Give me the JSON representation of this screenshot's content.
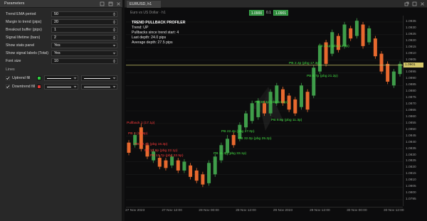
{
  "panel": {
    "title": "Parameters",
    "icons": [
      "pin-icon",
      "maximize-icon",
      "close-icon"
    ],
    "params": [
      {
        "label": "Trend EMA period",
        "value": "50"
      },
      {
        "label": "Margin to trend (pips)",
        "value": "20"
      },
      {
        "label": "Breakout buffer (pips)",
        "value": "1"
      },
      {
        "label": "Signal lifetime (bars)",
        "value": "2"
      },
      {
        "label": "Show stats panel",
        "value": "Yes"
      },
      {
        "label": "Show signal labels (Total)",
        "value": "Yes"
      },
      {
        "label": "Font size",
        "value": "10"
      }
    ],
    "lines_header": "Lines",
    "lines": [
      {
        "label": "Uptrend fill",
        "color": "#2ecc40",
        "checked": true
      },
      {
        "label": "Downtrend fill",
        "color": "#e53935",
        "checked": true
      }
    ]
  },
  "chart_window": {
    "tab_label": "EURUSD, h1",
    "header_text": "Euro vs US Dollar · h1",
    "sell_price": "1.0900",
    "spread": "0.1",
    "buy_price": "1.0901",
    "icons": [
      "detach-icon",
      "maximize-icon",
      "close-icon"
    ]
  },
  "info": {
    "title": "TREND PULLBACK PROFILER",
    "lines": [
      "Trend: UP",
      "Pullbacks since trend start: 4",
      "Last depth: 24.0 pips",
      "Average depth: 27.5 pips"
    ]
  },
  "chart_data": {
    "type": "candlestick",
    "ylim": [
      1.079,
      1.094
    ],
    "up_color": "#3f9d4a",
    "down_color": "#e8692e",
    "current_price": 1.0901,
    "current_price_label": "1.0901",
    "price_line_color": "#c9c46a",
    "y_ticks": [
      "1.0935",
      "1.0930",
      "1.0925",
      "1.0920",
      "1.0915",
      "1.0910",
      "1.0905",
      "1.0900",
      "1.0895",
      "1.0890",
      "1.0885",
      "1.0880",
      "1.0875",
      "1.0870",
      "1.0865",
      "1.0860",
      "1.0855",
      "1.0850",
      "1.0845",
      "1.0840",
      "1.0835",
      "1.0830",
      "1.0825",
      "1.0820",
      "1.0815",
      "1.0810",
      "1.0805",
      "1.0800",
      "1.0795"
    ],
    "x_ticks": [
      {
        "candle": 1,
        "label": "27 Nov 2023"
      },
      {
        "candle": 7,
        "label": "27 Nov 12:00"
      },
      {
        "candle": 13,
        "label": "28 Nov 00:00"
      },
      {
        "candle": 19,
        "label": "28 Nov 12:00"
      },
      {
        "candle": 25,
        "label": "29 Nov 2023"
      },
      {
        "candle": 31,
        "label": "29 Nov 12:00"
      },
      {
        "candle": 37,
        "label": "30 Nov 00:00"
      },
      {
        "candle": 43,
        "label": "30 Nov 12:00"
      }
    ],
    "candles": [
      [
        1.084,
        1.0842,
        1.083,
        1.0832
      ],
      [
        1.0838,
        1.0848,
        1.0836,
        1.0846
      ],
      [
        1.0852,
        1.0855,
        1.0833,
        1.0835
      ],
      [
        1.0838,
        1.084,
        1.0827,
        1.0829
      ],
      [
        1.0826,
        1.0835,
        1.0824,
        1.0833
      ],
      [
        1.0828,
        1.083,
        1.0819,
        1.0821
      ],
      [
        1.0826,
        1.0828,
        1.0818,
        1.082
      ],
      [
        1.0822,
        1.0831,
        1.082,
        1.0829
      ],
      [
        1.0826,
        1.0828,
        1.0816,
        1.0818
      ],
      [
        1.0818,
        1.0827,
        1.0816,
        1.0825
      ],
      [
        1.0822,
        1.0824,
        1.0811,
        1.0813
      ],
      [
        1.0818,
        1.082,
        1.0808,
        1.081
      ],
      [
        1.0815,
        1.0817,
        1.0805,
        1.0807
      ],
      [
        1.0808,
        1.0826,
        1.0806,
        1.0824
      ],
      [
        1.0815,
        1.0831,
        1.0813,
        1.0829
      ],
      [
        1.0826,
        1.084,
        1.0824,
        1.0838
      ],
      [
        1.0832,
        1.0846,
        1.083,
        1.0843
      ],
      [
        1.0846,
        1.0848,
        1.0836,
        1.0838
      ],
      [
        1.0843,
        1.0856,
        1.0841,
        1.0854
      ],
      [
        1.0852,
        1.0865,
        1.085,
        1.0863
      ],
      [
        1.0857,
        1.0873,
        1.0855,
        1.0871
      ],
      [
        1.086,
        1.0875,
        1.0858,
        1.0873
      ],
      [
        1.0871,
        1.0873,
        1.0861,
        1.0863
      ],
      [
        1.0863,
        1.0882,
        1.0861,
        1.088
      ],
      [
        1.0871,
        1.0887,
        1.0869,
        1.0885
      ],
      [
        1.0882,
        1.0884,
        1.0869,
        1.0871
      ],
      [
        1.0877,
        1.0879,
        1.0864,
        1.0866
      ],
      [
        1.0874,
        1.0876,
        1.0861,
        1.0863
      ],
      [
        1.0868,
        1.0887,
        1.0866,
        1.0885
      ],
      [
        1.088,
        1.0882,
        1.0864,
        1.0866
      ],
      [
        1.0877,
        1.0901,
        1.0875,
        1.0899
      ],
      [
        1.0896,
        1.0918,
        1.0894,
        1.0916
      ],
      [
        1.0919,
        1.0921,
        1.09,
        1.0902
      ],
      [
        1.091,
        1.0929,
        1.0908,
        1.0927
      ],
      [
        1.0924,
        1.0926,
        1.0911,
        1.0913
      ],
      [
        1.0916,
        1.0935,
        1.0914,
        1.0933
      ],
      [
        1.093,
        1.0932,
        1.092,
        1.0922
      ],
      [
        1.0924,
        1.0938,
        1.0922,
        1.0936
      ],
      [
        1.0933,
        1.0935,
        1.0914,
        1.0916
      ],
      [
        1.0919,
        1.0932,
        1.0917,
        1.093
      ],
      [
        1.0922,
        1.0924,
        1.0906,
        1.0908
      ],
      [
        1.091,
        1.0912,
        1.0894,
        1.0896
      ],
      [
        1.0902,
        1.0904,
        1.0886,
        1.0888
      ],
      [
        1.0885,
        1.0898,
        1.0883,
        1.0896
      ],
      [
        1.0894,
        1.0904,
        1.0892,
        1.0902
      ]
    ],
    "annotations": [
      {
        "text": "Pullback 1 (17.1p)",
        "color": "#ff3b3b"
      },
      {
        "text": "PB 2 (14.8p)",
        "color": "#ff3b3b"
      },
      {
        "text": "PB 12.4p (pbg 16.3p)",
        "color": "#ff3b3b"
      },
      {
        "text": "PB 10.9p (pbg 22.1p)",
        "color": "#ff3b3b"
      },
      {
        "text": "PB 13.7p (pbg 22.5p)",
        "color": "#ff3b3b"
      },
      {
        "text": "PB 22.4p (pbg 27.0p)",
        "color": "#44e044"
      },
      {
        "text": "PB 32.0p (pbg 25.2p)",
        "color": "#44e044"
      },
      {
        "text": "PB 11.3p (pbg 33.1p)",
        "color": "#44e044"
      },
      {
        "text": "PB 6.9p (pbg 11.3p)",
        "color": "#44e044"
      },
      {
        "text": "PB 6.7p (pbg 21.2p)",
        "color": "#44e044"
      },
      {
        "text": "PB 2.4p (pbg 17.3p)",
        "color": "#44e044"
      },
      {
        "text": "PB 3.1p (pbg 13.3p)",
        "color": "#44e044"
      },
      {
        "text": "PB 38.2p (pbg 14.4p)",
        "color": "#44e044"
      }
    ]
  }
}
